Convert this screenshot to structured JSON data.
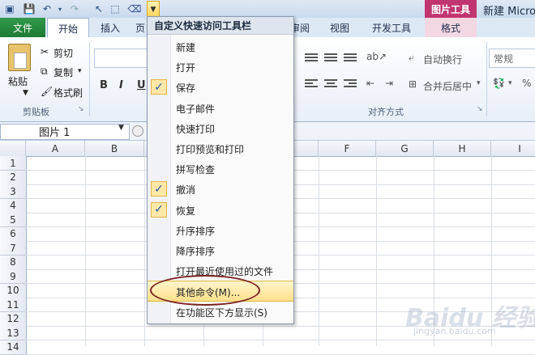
{
  "title_bar": {
    "picture_tools": "图片工具",
    "doc_title": "新建 Micro"
  },
  "tabs": [
    {
      "label": "文件"
    },
    {
      "label": "开始"
    },
    {
      "label": "插入"
    },
    {
      "label": "页"
    },
    {
      "label": "审阅"
    },
    {
      "label": "视图"
    },
    {
      "label": "开发工具"
    },
    {
      "label": "格式"
    }
  ],
  "ribbon": {
    "clipboard": {
      "paste": "粘贴",
      "cut": "剪切",
      "copy": "复制",
      "format_painter": "格式刷",
      "group_label": "剪贴板"
    },
    "font": {
      "bold": "B",
      "italic": "I",
      "underline": "U"
    },
    "alignment": {
      "wrap_text": "自动换行",
      "merge_center": "合并后居中",
      "group_label": "对齐方式"
    },
    "number": {
      "format_value": "常规",
      "percent": "%"
    }
  },
  "formula_bar": {
    "name_box": "图片 1"
  },
  "grid": {
    "columns": [
      "A",
      "B",
      "",
      "",
      "",
      "F",
      "G",
      "H",
      "I"
    ],
    "rows": [
      "1",
      "2",
      "3",
      "4",
      "5",
      "6",
      "7",
      "8",
      "9",
      "10",
      "11",
      "12",
      "13",
      "14"
    ]
  },
  "qa_menu": {
    "title": "自定义快速访问工具栏",
    "items": [
      {
        "label": "新建",
        "checked": false
      },
      {
        "label": "打开",
        "checked": false
      },
      {
        "label": "保存",
        "checked": true
      },
      {
        "label": "电子邮件",
        "checked": false
      },
      {
        "label": "快速打印",
        "checked": false
      },
      {
        "label": "打印预览和打印",
        "checked": false
      },
      {
        "label": "拼写检查",
        "checked": false
      },
      {
        "label": "撤消",
        "checked": true
      },
      {
        "label": "恢复",
        "checked": true
      },
      {
        "label": "升序排序",
        "checked": false
      },
      {
        "label": "降序排序",
        "checked": false
      },
      {
        "label": "打开最近使用过的文件",
        "checked": false
      },
      {
        "label": "其他命令(M)...",
        "checked": false,
        "highlighted": true
      },
      {
        "label": "在功能区下方显示(S)",
        "checked": false
      }
    ]
  },
  "watermark": {
    "brand": "Baidu 经验",
    "url": "jingyan.baidu.com"
  },
  "colors": {
    "file_tab": "#2f9a49",
    "picture_tools": "#c1356f",
    "highlight": "#ffe08a",
    "annotation": "#7a2222"
  }
}
